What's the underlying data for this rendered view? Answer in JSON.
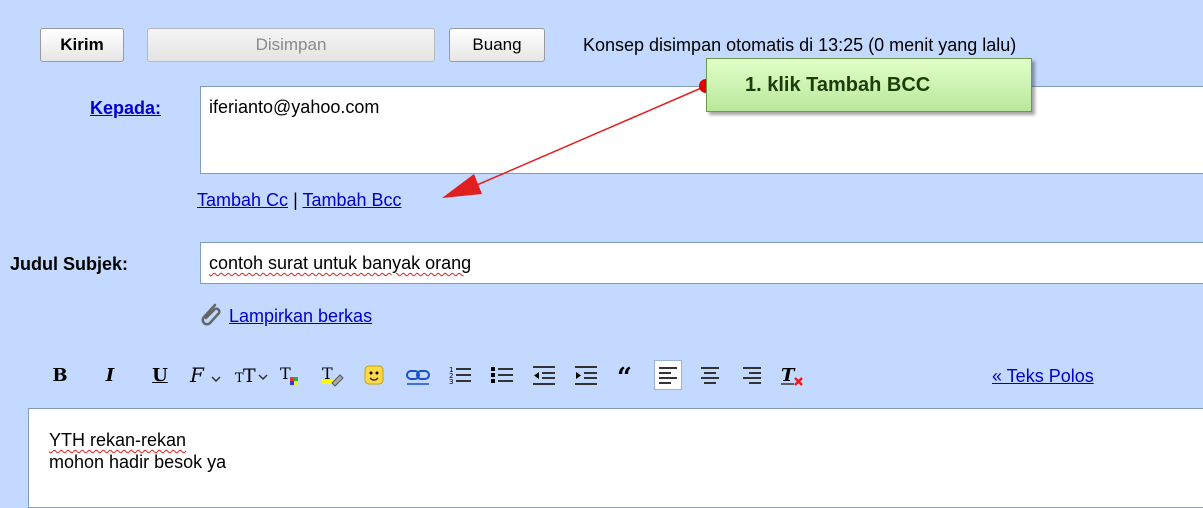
{
  "buttons": {
    "send": "Kirim",
    "saved": "Disimpan",
    "discard": "Buang"
  },
  "status": "Konsep disimpan otomatis di 13:25 (0 menit yang lalu)",
  "to": {
    "label": "Kepada:",
    "value": "iferianto@yahoo.com"
  },
  "cc_links": {
    "add_cc": "Tambah Cc",
    "separator": "|",
    "add_bcc": "Tambah Bcc"
  },
  "subject": {
    "label": "Judul Subjek:",
    "value": "contoh surat untuk banyak orang"
  },
  "attach": {
    "label": "Lampirkan berkas",
    "icon": "paperclip-icon"
  },
  "toolbar": {
    "bold": "B",
    "italic": "I",
    "underline": "U",
    "plain_text": "« Teks Polos"
  },
  "body_lines": [
    "YTH rekan-rekan",
    "mohon hadir besok ya"
  ],
  "callout": {
    "text": "1. klik Tambah BCC"
  },
  "colors": {
    "background": "#c3d9ff",
    "link": "#0000cc",
    "arrow": "#e02020",
    "callout_bg": "#c9f0a8"
  }
}
